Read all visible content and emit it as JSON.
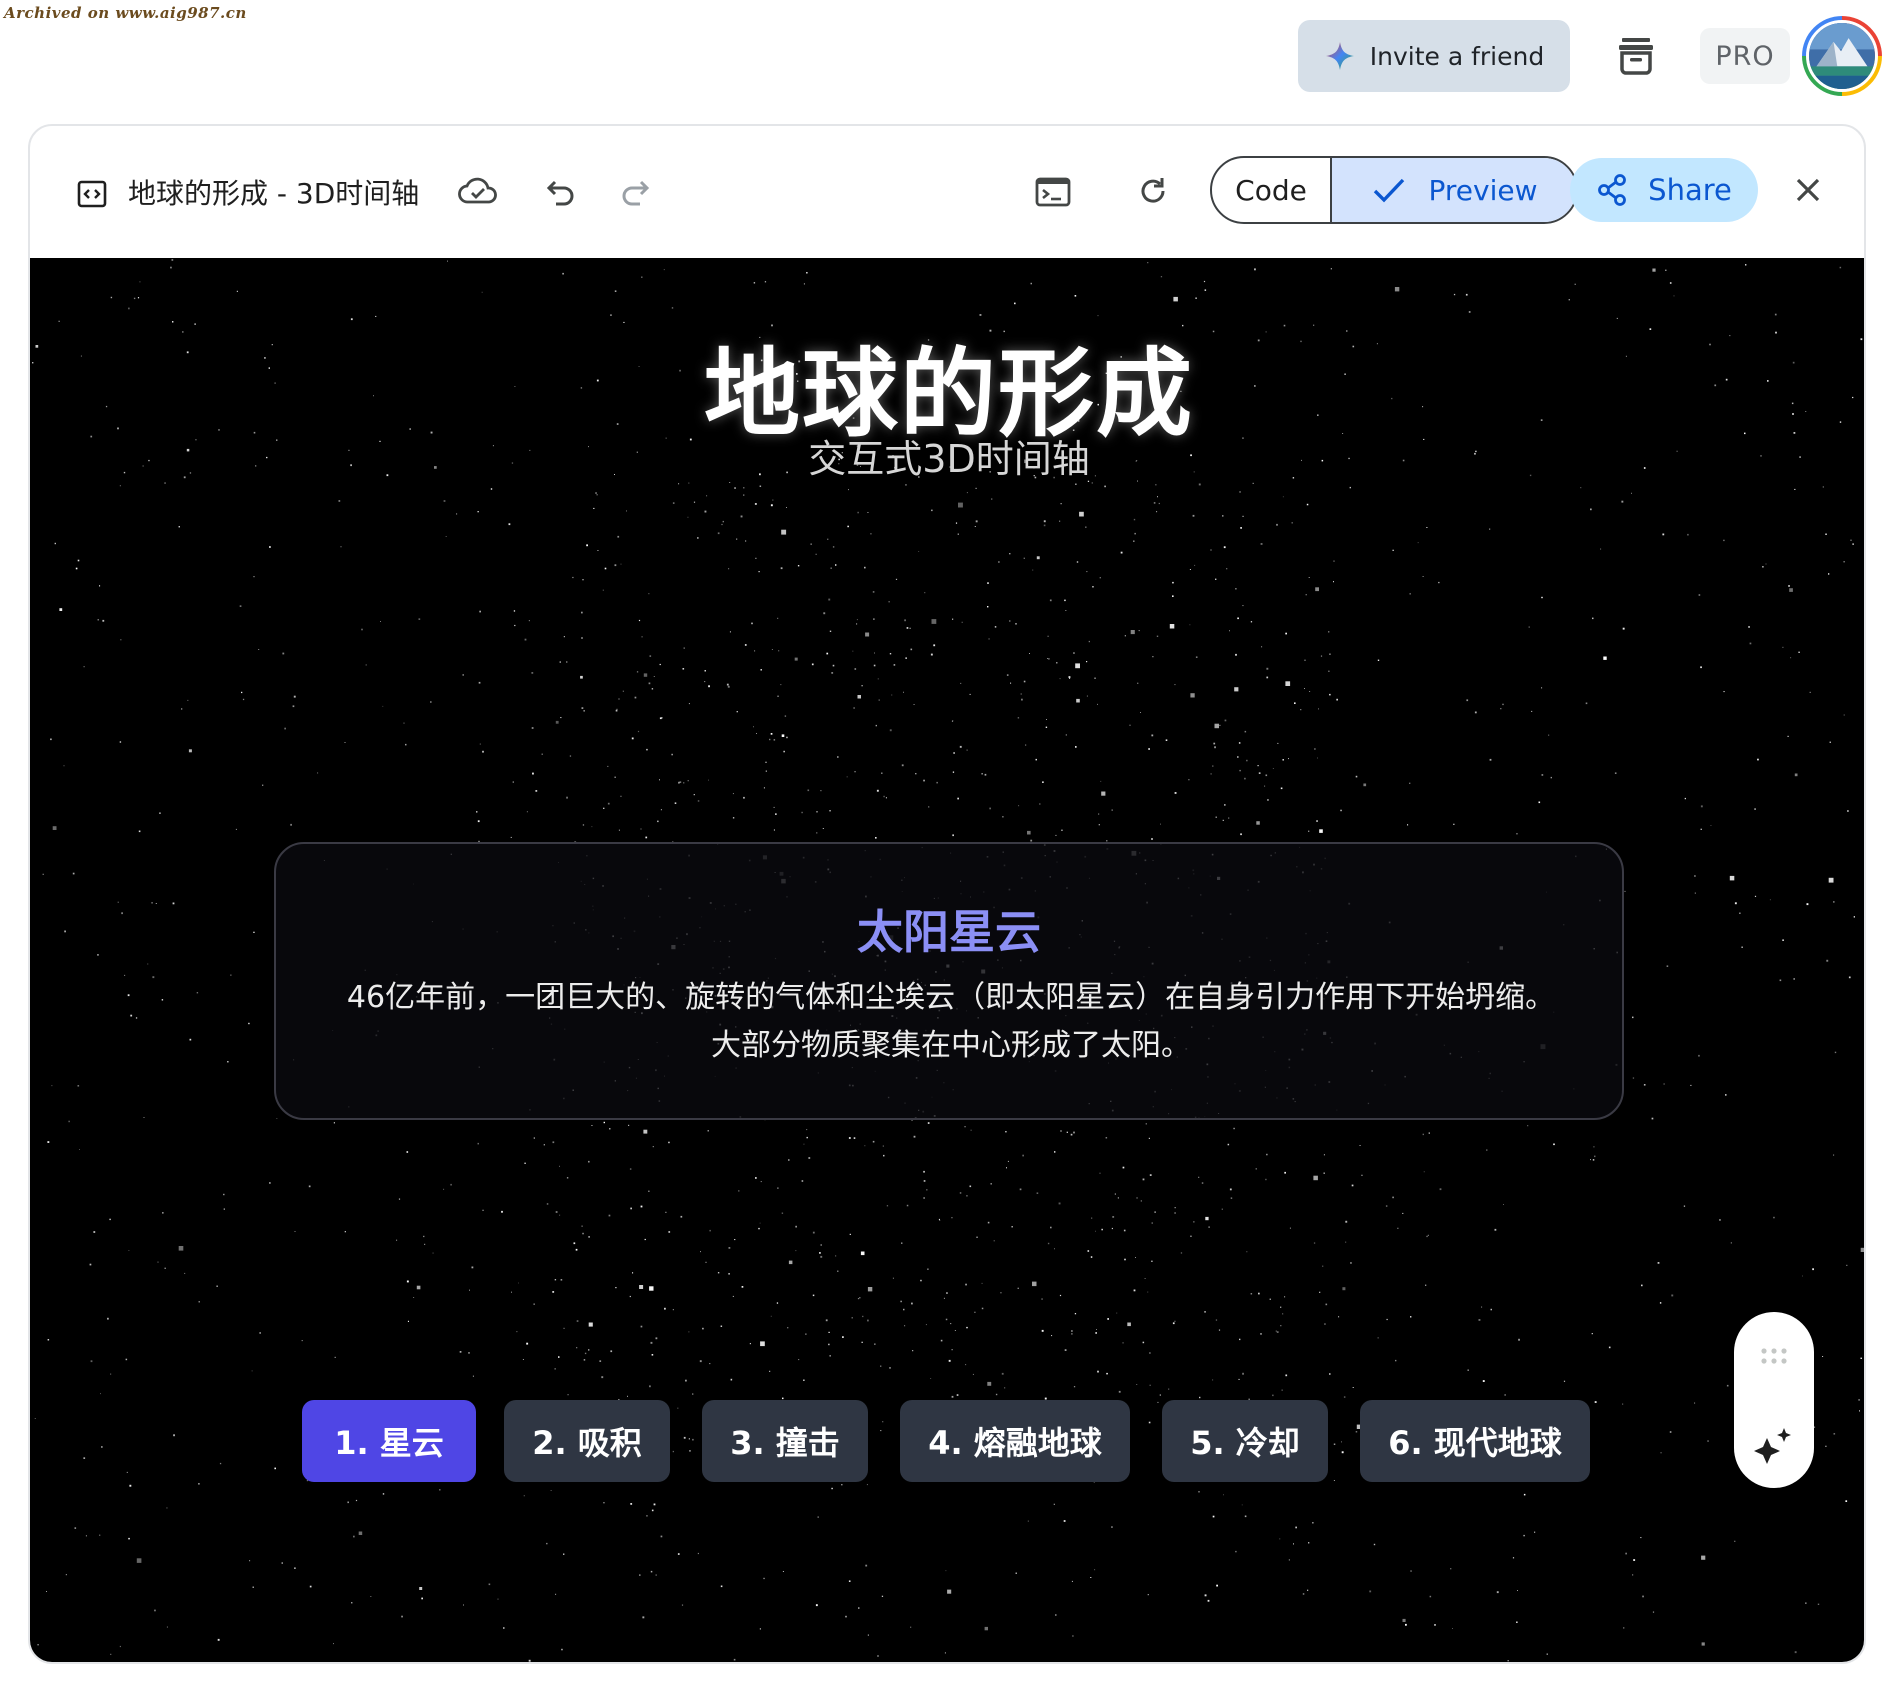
{
  "watermark": "Archived on www.aig987.cn",
  "top_bar": {
    "invite_label": "Invite a friend",
    "pro_label": "PRO"
  },
  "toolbar": {
    "doc_title": "地球的形成 - 3D时间轴",
    "code_label": "Code",
    "preview_label": "Preview",
    "share_label": "Share"
  },
  "preview": {
    "title": "地球的形成",
    "subtitle": "交互式3D时间轴",
    "card": {
      "title": "太阳星云",
      "description": "46亿年前，一团巨大的、旋转的气体和尘埃云（即太阳星云）在自身引力作用下开始坍缩。大部分物质聚集在中心形成了太阳。"
    },
    "stages": [
      {
        "label": "1. 星云",
        "active": true
      },
      {
        "label": "2. 吸积",
        "active": false
      },
      {
        "label": "3. 撞击",
        "active": false
      },
      {
        "label": "4. 熔融地球",
        "active": false
      },
      {
        "label": "5. 冷却",
        "active": false
      },
      {
        "label": "6. 现代地球",
        "active": false
      }
    ]
  },
  "colors": {
    "accent": "#0b57d0",
    "active_stage": "#4f46e5",
    "inactive_stage": "#2f3643",
    "card_title": "#8b8ff5"
  },
  "icons": [
    "code-window-icon",
    "cloud-saved-icon",
    "undo-icon",
    "redo-icon",
    "terminal-icon",
    "refresh-icon",
    "check-icon",
    "share-icon",
    "close-icon",
    "sparkle-icon",
    "archive-icon",
    "drag-handle-icon",
    "magic-wand-icon"
  ]
}
